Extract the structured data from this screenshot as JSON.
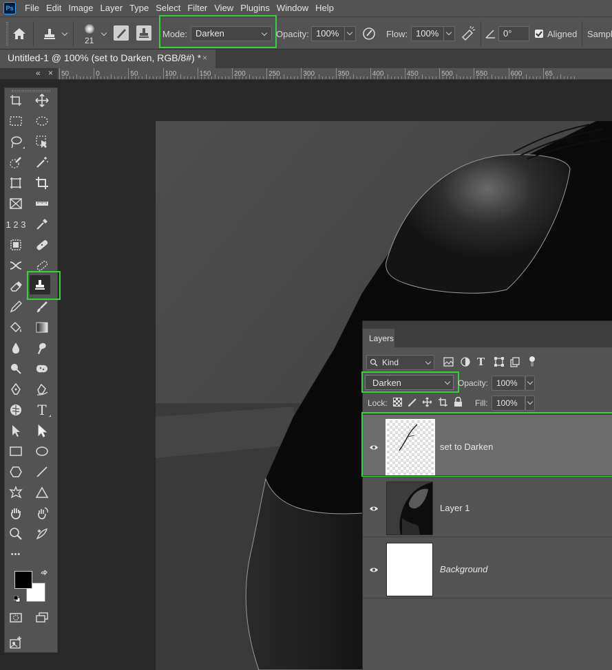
{
  "app": {
    "logo": "Ps"
  },
  "menu": [
    "File",
    "Edit",
    "Image",
    "Layer",
    "Type",
    "Select",
    "Filter",
    "View",
    "Plugins",
    "Window",
    "Help"
  ],
  "options": {
    "brush_size": "21",
    "mode_label": "Mode:",
    "mode_value": "Darken",
    "opacity_label": "Opacity:",
    "opacity_value": "100%",
    "flow_label": "Flow:",
    "flow_value": "100%",
    "angle_value": "0°",
    "aligned_label": "Aligned",
    "sample_label": "Sampl"
  },
  "document": {
    "tab_title": "Untitled-1 @ 100% (set to Darken, RGB/8#) *",
    "close_glyph": "×"
  },
  "ruler": {
    "labels": [
      "50",
      "0",
      "50",
      "100",
      "150",
      "200",
      "250",
      "300",
      "350",
      "400",
      "450",
      "500",
      "550",
      "600",
      "65"
    ]
  },
  "toolbox": {
    "collapse_glyph": "«",
    "close_glyph": "×",
    "more_glyph": "•••",
    "number_tool_label": "1 2 3"
  },
  "layers_panel": {
    "tab_label": "Layers",
    "kind_label": "Kind",
    "blend_mode": "Darken",
    "opacity_label": "Opacity:",
    "opacity_value": "100%",
    "lock_label": "Lock:",
    "fill_label": "Fill:",
    "fill_value": "100%",
    "layers": [
      {
        "name": "set to Darken",
        "selected": true
      },
      {
        "name": "Layer 1",
        "selected": false
      },
      {
        "name": "Background",
        "selected": false
      }
    ]
  },
  "colors": {
    "highlight": "#39d139",
    "foreground": "#000000",
    "background": "#ffffff"
  }
}
